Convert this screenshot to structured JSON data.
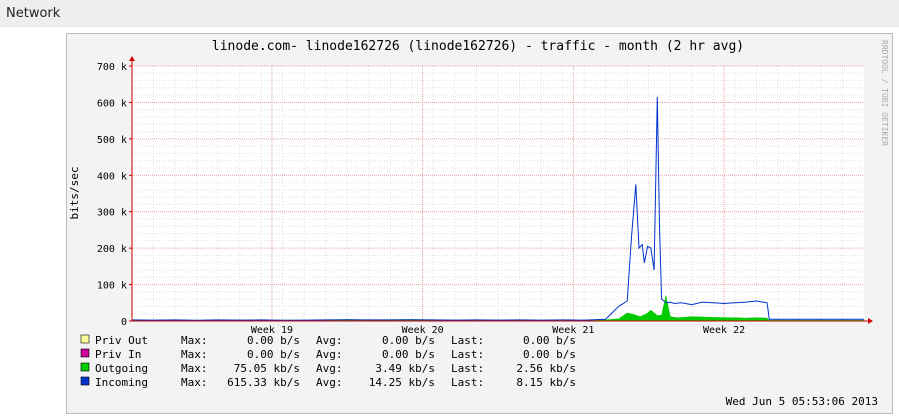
{
  "section": {
    "title": "Network"
  },
  "chart_data": {
    "type": "area",
    "title": "linode.com- linode162726 (linode162726) - traffic - month (2 hr avg)",
    "ylabel": "bits/sec",
    "xlabel": "",
    "ylim": [
      0,
      700000
    ],
    "yticks": [
      {
        "value": 0,
        "label": "0"
      },
      {
        "value": 100000,
        "label": "100 k"
      },
      {
        "value": 200000,
        "label": "200 k"
      },
      {
        "value": 300000,
        "label": "300 k"
      },
      {
        "value": 400000,
        "label": "400 k"
      },
      {
        "value": 500000,
        "label": "500 k"
      },
      {
        "value": 600000,
        "label": "600 k"
      },
      {
        "value": 700000,
        "label": "700 k"
      }
    ],
    "xlim": [
      0,
      34
    ],
    "xticks": [
      {
        "value": 6.5,
        "label": "Week 19"
      },
      {
        "value": 13.5,
        "label": "Week 20"
      },
      {
        "value": 20.5,
        "label": "Week 21"
      },
      {
        "value": 27.5,
        "label": "Week 22"
      }
    ],
    "grid": true,
    "watermark": "RRDTOOL / TOBI OETIKER",
    "timestamp": "Wed Jun  5 05:53:06 2013",
    "series": [
      {
        "name": "Priv Out",
        "color": "#ffff99",
        "stats": {
          "max": "0.00  b/s",
          "avg": "0.00  b/s",
          "last": "0.00  b/s"
        },
        "x": [],
        "y": []
      },
      {
        "name": "Priv In",
        "color": "#cc0099",
        "stats": {
          "max": "0.00  b/s",
          "avg": "0.00  b/s",
          "last": "0.00  b/s"
        },
        "x": [],
        "y": []
      },
      {
        "name": "Outgoing",
        "color": "#00cc00",
        "stats": {
          "max": "75.05 kb/s",
          "avg": "3.49 kb/s",
          "last": "2.56 kb/s"
        },
        "x": [
          0,
          1,
          2,
          3,
          4,
          5,
          6,
          7,
          8,
          9,
          10,
          11,
          12,
          13,
          14,
          15,
          16,
          17,
          18,
          19,
          20,
          21,
          22,
          22.6,
          23.0,
          23.3,
          23.6,
          23.9,
          24.1,
          24.4,
          24.6,
          24.8,
          25.0,
          25.3,
          25.6,
          26,
          27,
          28,
          28.5,
          29,
          29.5,
          29.6,
          34
        ],
        "y": [
          3000,
          2000,
          3000,
          2000,
          2500,
          3000,
          2000,
          2500,
          2000,
          3000,
          4000,
          3000,
          3500,
          4000,
          3000,
          2500,
          3000,
          2500,
          3000,
          2000,
          2500,
          2000,
          3000,
          6000,
          22000,
          18000,
          12000,
          20000,
          30000,
          15000,
          16000,
          70000,
          12000,
          9000,
          10000,
          12000,
          10000,
          9000,
          8000,
          9000,
          8000,
          2500,
          2500
        ]
      },
      {
        "name": "Incoming",
        "color": "#0033cc",
        "stats": {
          "max": "615.33 kb/s",
          "avg": "14.25 kb/s",
          "last": "8.15 kb/s"
        },
        "x": [
          0,
          1,
          2,
          3,
          4,
          5,
          6,
          7,
          8,
          9,
          10,
          11,
          12,
          13,
          14,
          15,
          16,
          17,
          18,
          19,
          20,
          21,
          22,
          22.6,
          23.0,
          23.2,
          23.4,
          23.55,
          23.7,
          23.8,
          23.95,
          24.1,
          24.25,
          24.4,
          24.5,
          24.6,
          24.7,
          24.85,
          25.0,
          25.2,
          25.5,
          26,
          26.5,
          27,
          27.5,
          28,
          28.5,
          29,
          29.3,
          29.5,
          29.6,
          34
        ],
        "y": [
          3000,
          2500,
          3000,
          2000,
          3000,
          2500,
          3000,
          2000,
          2500,
          3000,
          3500,
          3000,
          3000,
          3500,
          3000,
          2500,
          3000,
          2500,
          3000,
          2500,
          3000,
          2500,
          5000,
          40000,
          55000,
          230000,
          375000,
          200000,
          210000,
          160000,
          205000,
          200000,
          140000,
          615000,
          260000,
          60000,
          55000,
          50000,
          52000,
          48000,
          50000,
          45000,
          52000,
          50000,
          48000,
          50000,
          52000,
          55000,
          52000,
          50000,
          5000,
          5000
        ]
      }
    ]
  }
}
